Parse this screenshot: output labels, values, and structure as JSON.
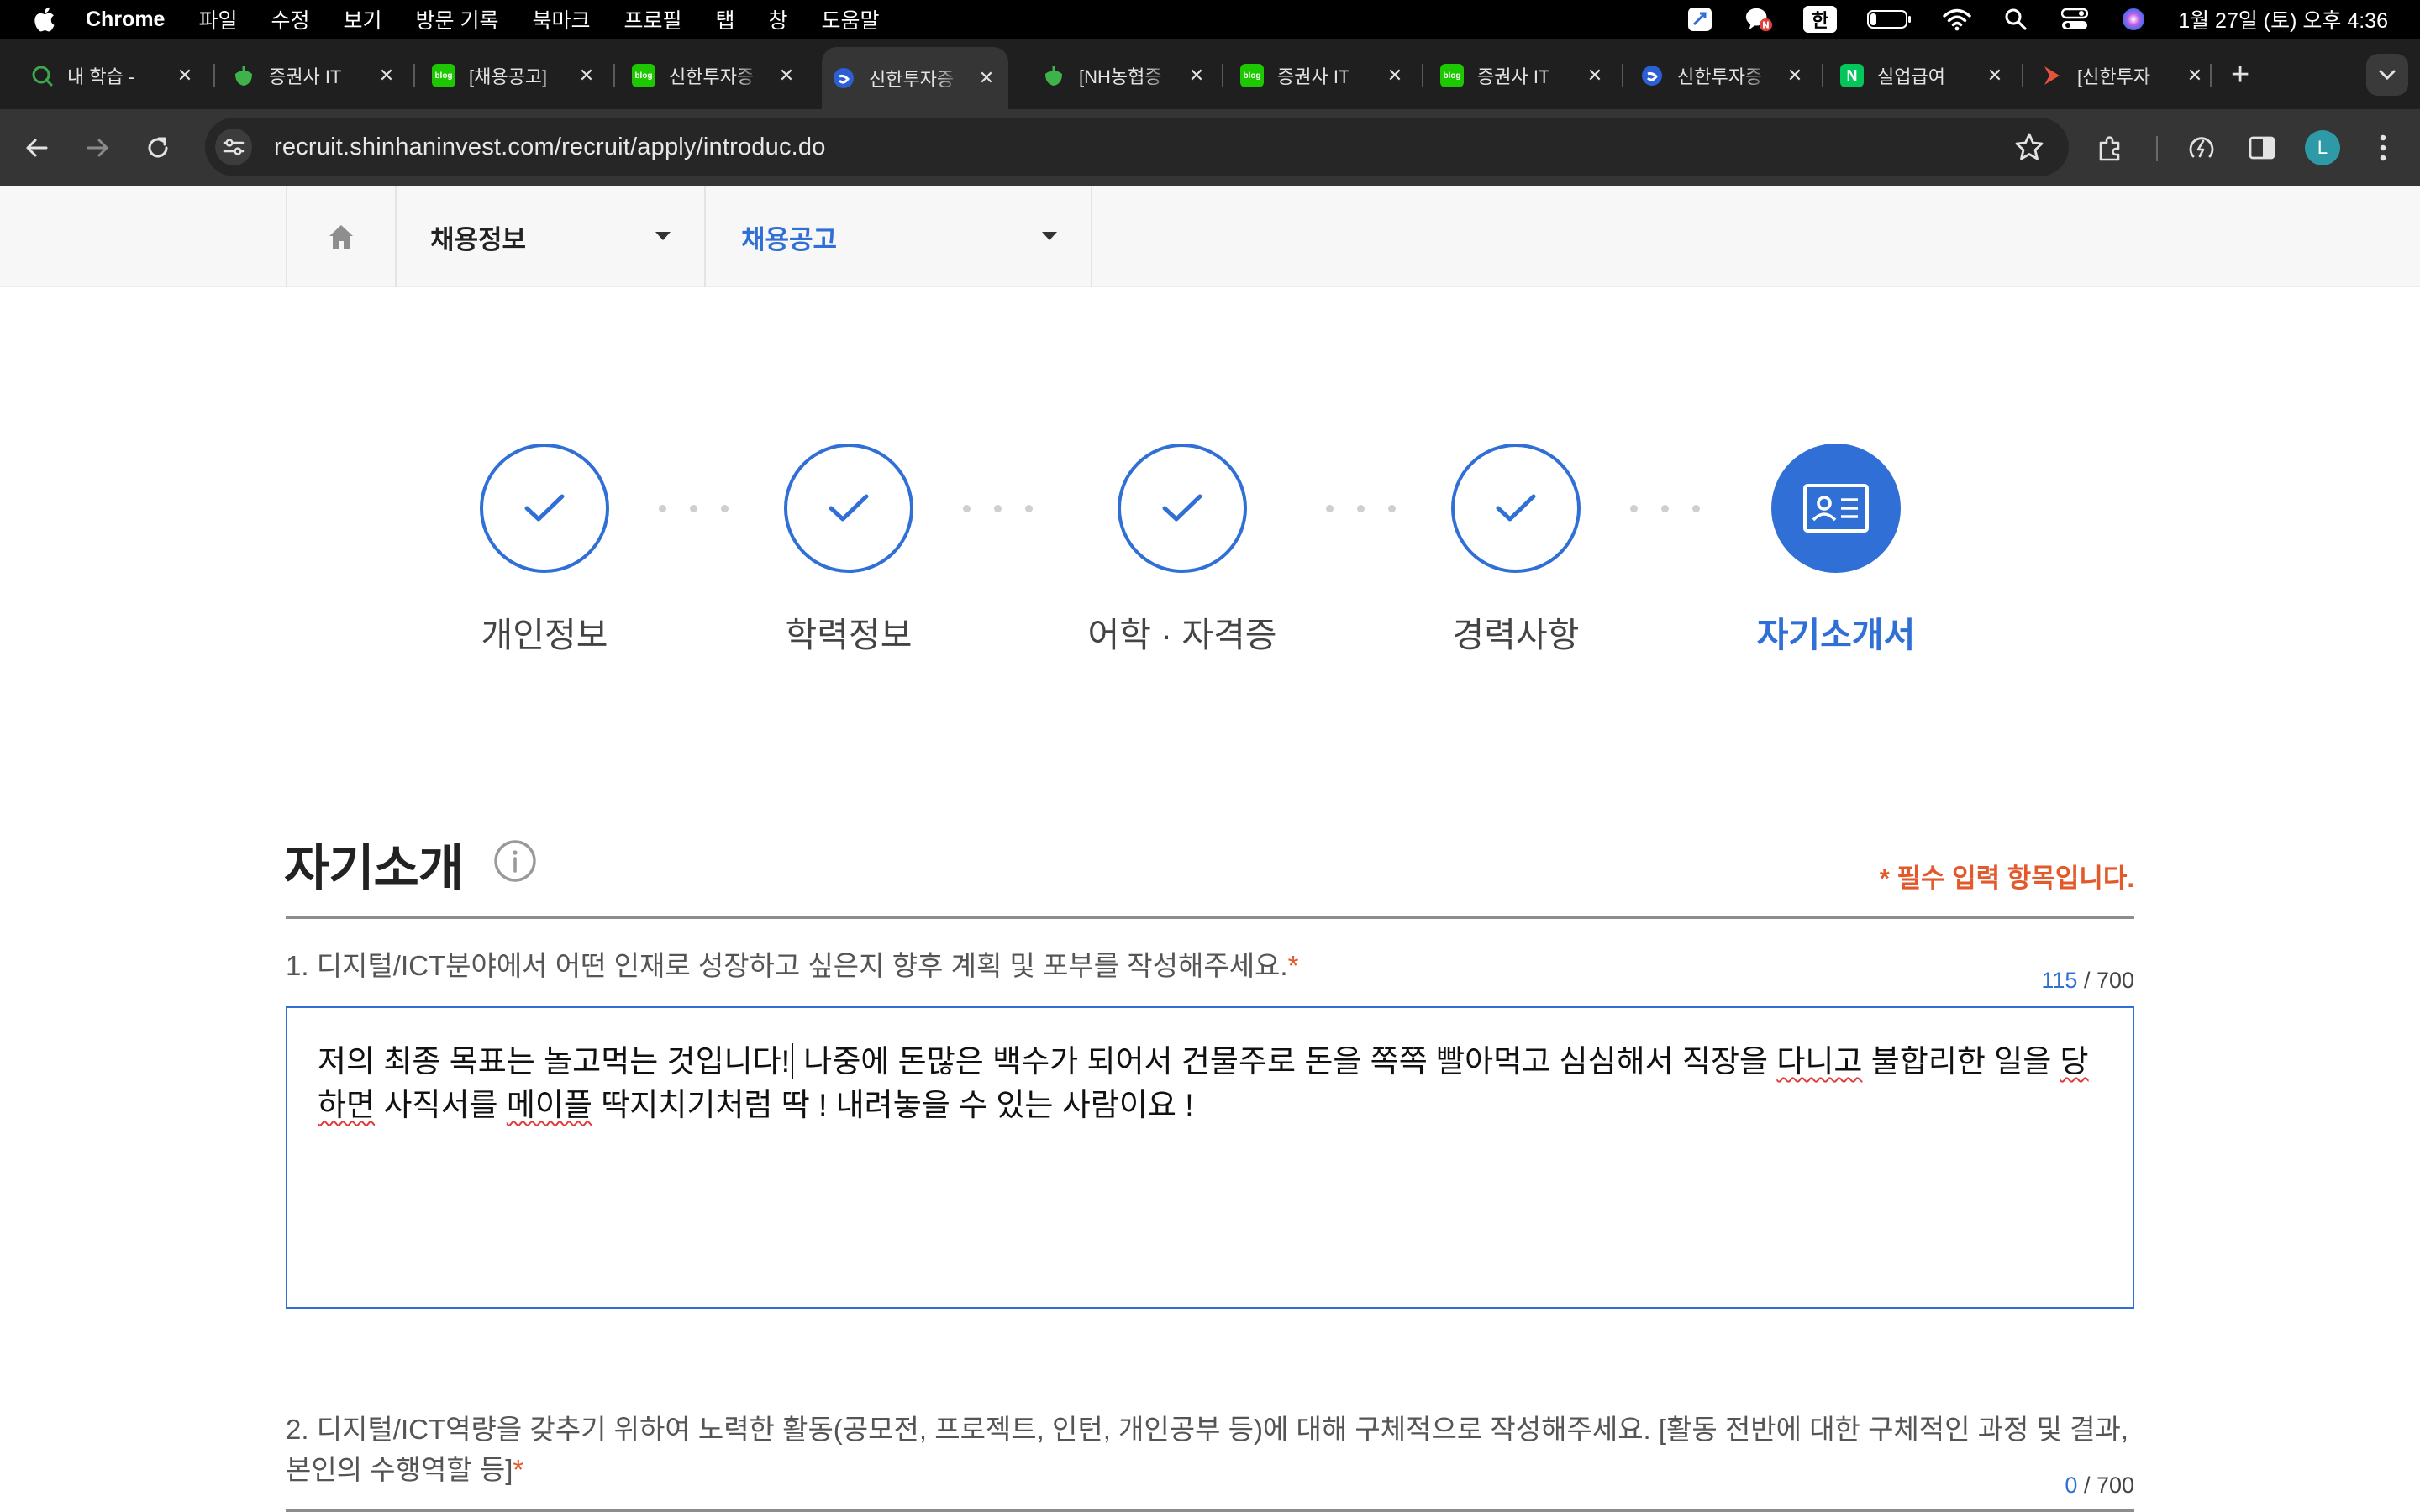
{
  "menubar": {
    "app": "Chrome",
    "items": [
      "파일",
      "수정",
      "보기",
      "방문 기록",
      "북마크",
      "프로필",
      "탭",
      "창",
      "도움말"
    ],
    "ime": "한",
    "clock": "1월 27일 (토) 오후 4:36"
  },
  "tabs": [
    {
      "title": "내 학습 - ",
      "icon": "learning-icon",
      "color": "#3ea64f"
    },
    {
      "title": "증권사 IT",
      "icon": "cafe-icon",
      "color": "#3fb24a"
    },
    {
      "title": "[채용공고]",
      "icon": "blog-icon",
      "color": "#1ec800"
    },
    {
      "title": "신한투자증",
      "icon": "blog-icon",
      "color": "#1ec800"
    },
    {
      "title": "신한투자증",
      "icon": "shinhan-icon",
      "color": "#2c5fd4",
      "active": true
    },
    {
      "title": "[NH농협증",
      "icon": "cafe-icon",
      "color": "#3fb24a"
    },
    {
      "title": "증권사 IT",
      "icon": "blog-icon",
      "color": "#1ec800"
    },
    {
      "title": "증권사 IT",
      "icon": "blog-icon",
      "color": "#1ec800"
    },
    {
      "title": "신한투자증",
      "icon": "shinhan-icon",
      "color": "#2c5fd4"
    },
    {
      "title": "실업급여 ",
      "icon": "naver-icon",
      "color": "#03c75a"
    },
    {
      "title": "[신한투자",
      "icon": "arrow-icon",
      "color": "#e5533d"
    }
  ],
  "toolbar": {
    "url": "recruit.shinhaninvest.com/recruit/apply/introduc.do",
    "profile_initial": "L"
  },
  "subnav": {
    "menu1": "채용정보",
    "menu2": "채용공고"
  },
  "steps": [
    {
      "label": "개인정보",
      "state": "done"
    },
    {
      "label": "학력정보",
      "state": "done"
    },
    {
      "label": "어학 · 자격증",
      "state": "done"
    },
    {
      "label": "경력사항",
      "state": "done"
    },
    {
      "label": "자기소개서",
      "state": "current"
    }
  ],
  "section": {
    "title": "자기소개",
    "required_note": "* 필수 입력 항목입니다."
  },
  "questions": [
    {
      "text": "1. 디지털/ICT분야에서 어떤 인재로 성장하고 싶은지 향후 계획 및 포부를 작성해주세요.",
      "required_mark": "*",
      "count": "115",
      "max": "/ 700",
      "answer": {
        "p1": "저의 최종 목표는 놀고먹는 것입니다!",
        "p2": " 나중에 돈많은 백수가 되어서 건물주로 돈을 쪽쪽 빨아먹고 심심해서 직장을 ",
        "p3": "다니고",
        "p4": " 불합리한 일을 ",
        "p5": "당하면",
        "p6": " 사직서를 ",
        "p7": "메이플",
        "p8": " 딱지치기처럼 딱 ! 내려놓을 수 있는 사람이요 !"
      }
    },
    {
      "text": "2. 디지털/ICT역량을 갖추기 위하여 노력한 활동(공모전, 프로젝트, 인턴, 개인공부 등)에 대해 구체적으로 작성해주세요. [활동 전반에 대한 구체적인 과정 및 결과, 본인의 수행역할 등]",
      "required_mark": "*",
      "count": "0",
      "max": "/ 700"
    }
  ],
  "colors": {
    "accent": "#2f6fd6",
    "required": "#e2592c"
  }
}
